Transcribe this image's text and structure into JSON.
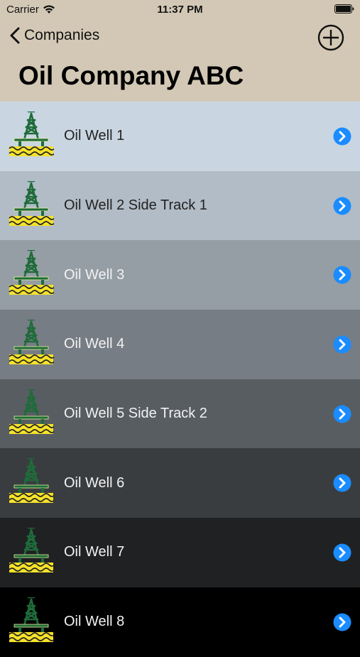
{
  "status": {
    "carrier": "Carrier",
    "time": "11:37 PM"
  },
  "nav": {
    "back_label": "Companies",
    "title": "Oil Company ABC"
  },
  "icons": {
    "back": "chevron-left-icon",
    "add": "plus-circle-icon",
    "row": "oil-rig-icon",
    "disclosure": "chevron-right-circle-icon"
  },
  "colors": {
    "header": "#d3c8b5",
    "accent": "#1a8cff",
    "rig_green": "#1f6b3a",
    "water_yellow": "#f5e22a"
  },
  "wells": [
    {
      "name": "Oil Well 1",
      "bg": "#c9d6e1",
      "text": "#222222"
    },
    {
      "name": "Oil Well 2 Side Track 1",
      "bg": "#b1bcc6",
      "text": "#222222"
    },
    {
      "name": "Oil Well 3",
      "bg": "#959ea5",
      "text": "#f2f2f2"
    },
    {
      "name": "Oil Well 4",
      "bg": "#777d84",
      "text": "#f2f2f2"
    },
    {
      "name": "Oil Well 5 Side Track 2",
      "bg": "#585d62",
      "text": "#f2f2f2"
    },
    {
      "name": "Oil Well 6",
      "bg": "#3a3d40",
      "text": "#f2f2f2"
    },
    {
      "name": "Oil Well 7",
      "bg": "#1f2123",
      "text": "#f2f2f2"
    },
    {
      "name": "Oil Well 8",
      "bg": "#000000",
      "text": "#f2f2f2"
    }
  ]
}
